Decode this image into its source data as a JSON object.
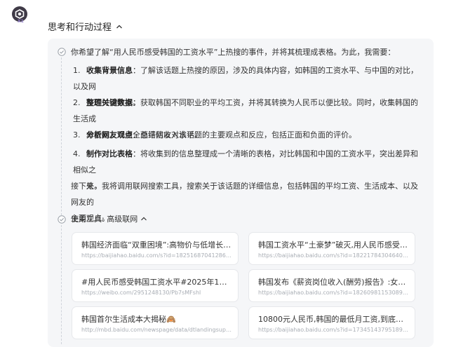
{
  "header": {
    "avatar_badge": "X1",
    "section_title": "思考和行动过程"
  },
  "thinking": {
    "intro": "你希望了解“用人民币感受韩国的工资水平”上热搜的事件，并将其梳理成表格。为此，我需要：",
    "steps": [
      {
        "num": "1.",
        "title": "收集背景信息",
        "text": "：了解该话题上热搜的原因，涉及的具体内容，如韩国的工资水平、与中国的对比，以及网",
        "cont": "友的讨论焦点。"
      },
      {
        "num": "2.",
        "title": "整理关键数据",
        "text": "：获取韩国不同职业的平均工资，并将其转换为人民币以便比较。同时，收集韩国的生活成",
        "cont": "本数据，以便全面评估收入水平。"
      },
      {
        "num": "3.",
        "title": "分析网友观点",
        "text": "：总结网友对该话题的主要观点和反应，包括正面和负面的评价。",
        "cont": ""
      },
      {
        "num": "4.",
        "title": "制作对比表格",
        "text": "：将收集到的信息整理成一个清晰的表格，对比韩国和中国的工资水平，突出差异和相似之",
        "cont": "处。"
      }
    ],
    "next_line1": "接下来，我将调用联网搜索工具，搜索关于该话题的详细信息，包括韩国的平均工资、生活成本、以及网友的",
    "next_line2": "主要观点。"
  },
  "tool": {
    "label": "使用工具: 高级联网"
  },
  "results": [
    {
      "title": "韩国经济面临“双重困境”:高物价与低增长加剧消...",
      "url": "https://baijiahao.baidu.com/s?id=1825168704128605238..."
    },
    {
      "title": "韩国工资水平“土豪梦”破灭,用人民币感受物价真...",
      "url": "https://baijiahao.baidu.com/s?id=1822178430464094469..."
    },
    {
      "title": "#用人民币感受韩国工资水平#2025年1月24日...",
      "url": "https://weibo.com/2951248130/Pb7sMFshl"
    },
    {
      "title": "韩国发布《薪资岗位收入(酬劳)报告》:女性平均...",
      "url": "https://baijiahao.baidu.com/s?id=1826098115308992875..."
    },
    {
      "title": "韩国首尔生活成本大揭秘🙈",
      "url": "http://mbd.baidu.com/newspage/data/dtlandingsuper?..."
    },
    {
      "title": "10800元人民币,韩国的最低月工资,到底为何会...",
      "url": "https://baijiahao.baidu.com/s?id=1734514379518907695..."
    }
  ]
}
